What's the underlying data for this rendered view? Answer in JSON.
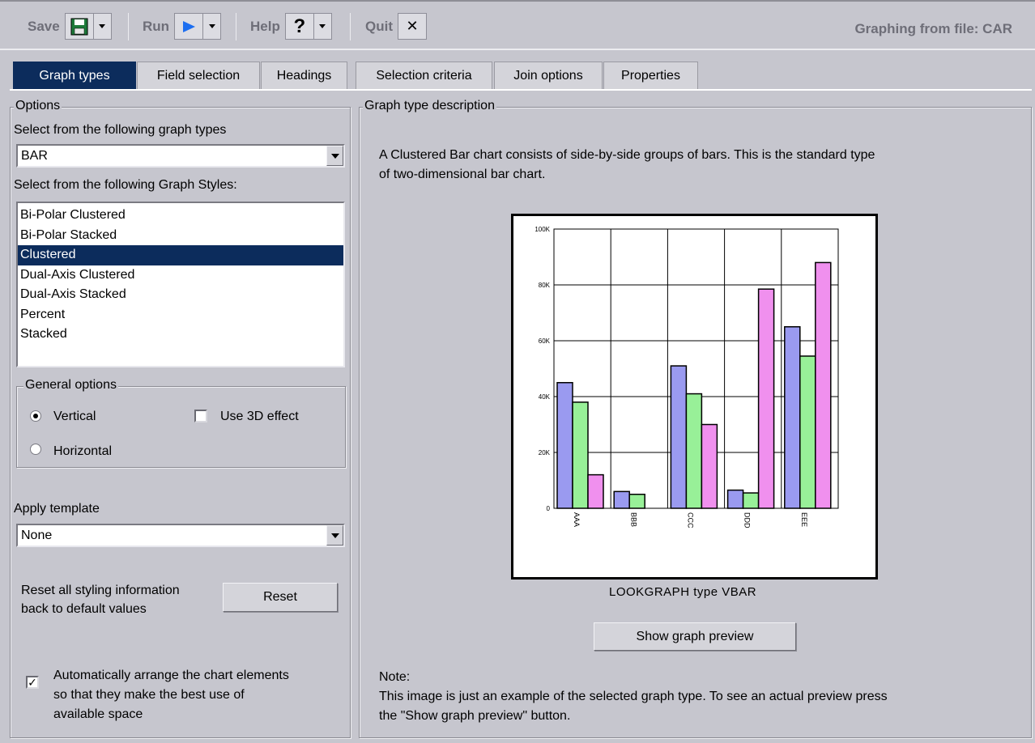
{
  "toolbar": {
    "save_label": "Save",
    "run_label": "Run",
    "help_label": "Help",
    "quit_label": "Quit",
    "help_glyph": "?",
    "quit_glyph": "✕",
    "title": "Graphing from file: CAR",
    "icons": [
      "floppy-disk-icon",
      "play-icon",
      "question-icon",
      "close-icon"
    ]
  },
  "tabs": [
    {
      "label": "Graph types",
      "active": true
    },
    {
      "label": "Field selection"
    },
    {
      "label": "Headings"
    },
    {
      "label": "Selection criteria"
    },
    {
      "label": "Join options"
    },
    {
      "label": "Properties"
    }
  ],
  "options": {
    "legend": "Options",
    "graph_types_label": "Select from the following graph types",
    "graph_type_value": "BAR",
    "graph_styles_label": "Select from the following Graph Styles:",
    "graph_styles": [
      "Bi-Polar Clustered",
      "Bi-Polar Stacked",
      "Clustered",
      "Dual-Axis Clustered",
      "Dual-Axis Stacked",
      "Percent",
      "Stacked"
    ],
    "selected_style": "Clustered",
    "general_options_legend": "General options",
    "vertical_label": "Vertical",
    "horizontal_label": "Horizontal",
    "orientation": "Vertical",
    "use_3d_label": "Use 3D effect",
    "use_3d_checked": false,
    "apply_template_label": "Apply template",
    "template_value": "None",
    "reset_text_line1": "Reset all styling information",
    "reset_text_line2": "back to default values",
    "reset_button": "Reset",
    "auto_arrange_line1": "Automatically arrange the chart elements",
    "auto_arrange_line2": "so that they make the best use of",
    "auto_arrange_line3": "available space",
    "auto_arrange_checked": true
  },
  "description": {
    "legend": "Graph type description",
    "text_line1": "A Clustered Bar chart consists of side-by-side groups of bars. This is the standard type",
    "text_line2": "of two-dimensional bar chart.",
    "caption": "LOOKGRAPH type VBAR",
    "preview_button": "Show graph preview",
    "note_label": "Note:",
    "note_line1": "This image is just an example of the selected graph type. To see an actual preview press",
    "note_line2": "the \"Show graph preview\" button."
  },
  "colors": {
    "selection": "#0c2c5c",
    "background": "#c6c6ce",
    "series1": "#9a9af0",
    "series2": "#98f098",
    "series3": "#f090ee",
    "run_icon": "#1c6ef0"
  },
  "chart_data": {
    "type": "bar",
    "categories": [
      "AAA",
      "BBB",
      "CCC",
      "DDD",
      "EEE"
    ],
    "series": [
      {
        "values": [
          45000,
          6000,
          51000,
          6500,
          65000
        ]
      },
      {
        "values": [
          38000,
          5000,
          41000,
          5500,
          54500
        ]
      },
      {
        "values": [
          12000,
          0,
          30000,
          78500,
          88000
        ]
      }
    ],
    "ylim": [
      0,
      100000
    ],
    "yticks": [
      "0",
      "20K",
      "40K",
      "60K",
      "80K",
      "100K"
    ],
    "grid": true
  }
}
